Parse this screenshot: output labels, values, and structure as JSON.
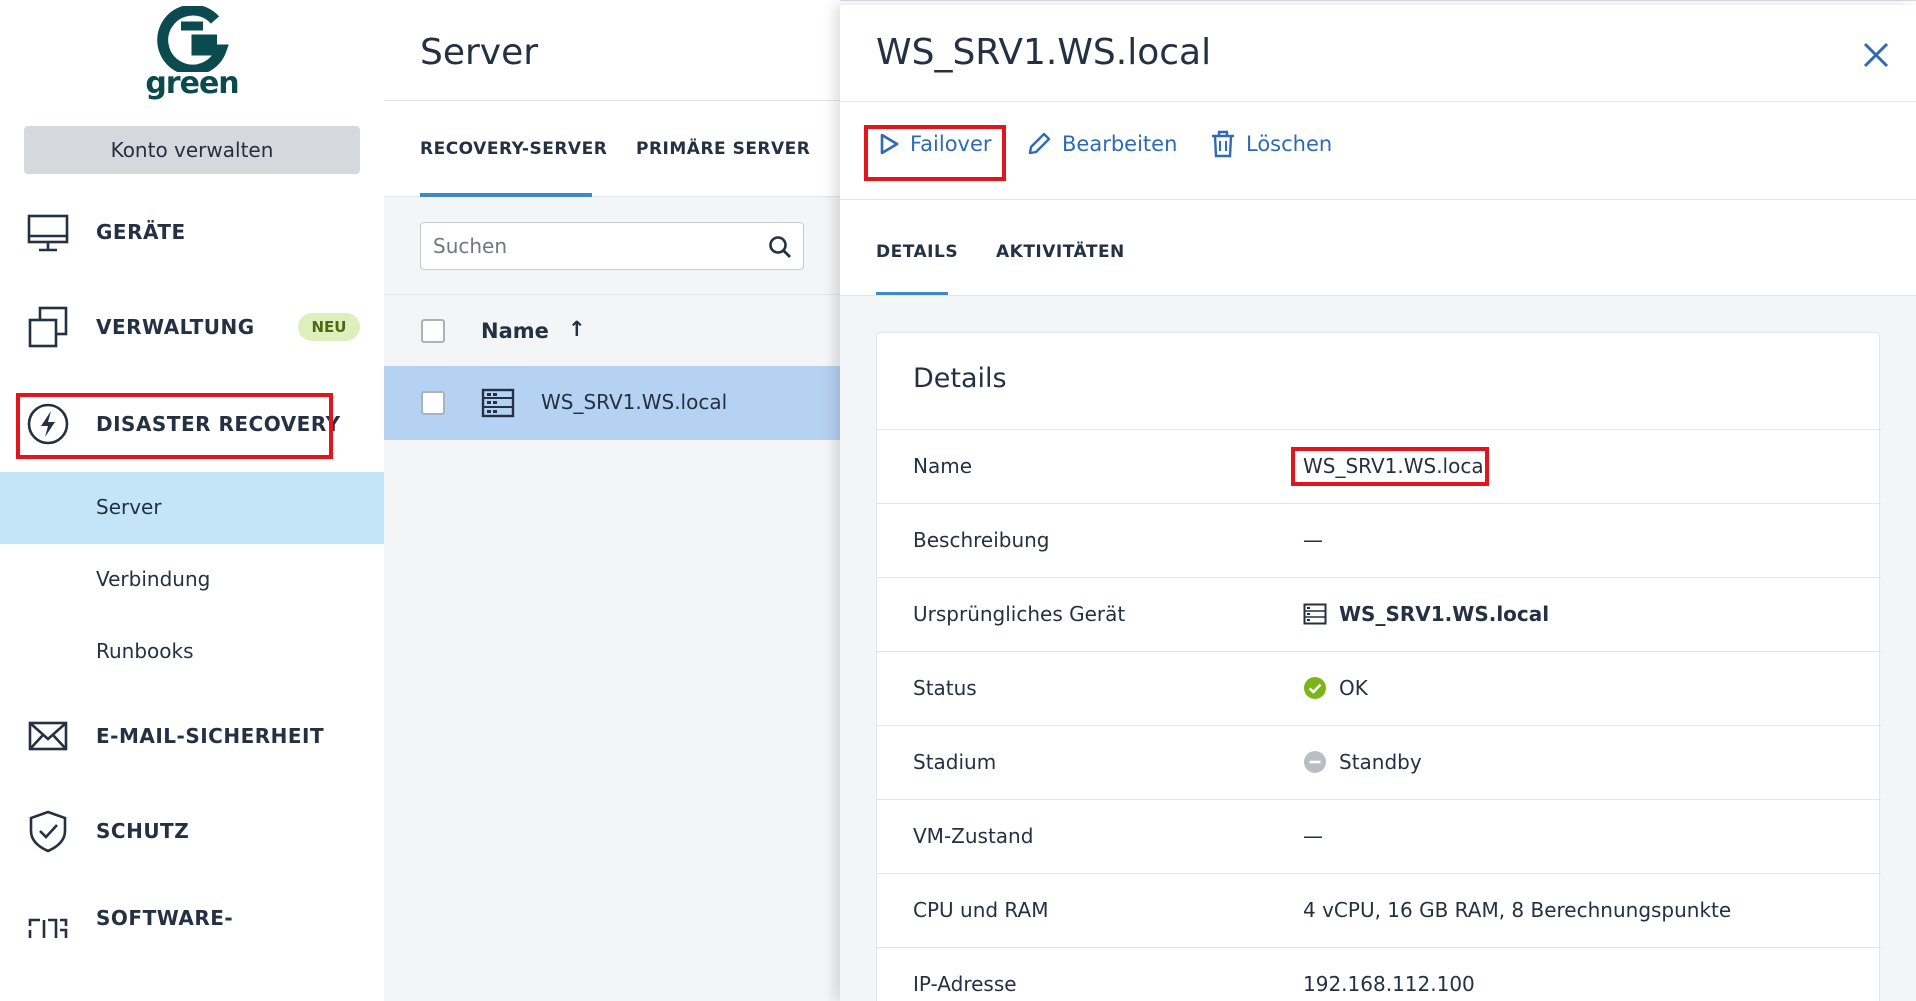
{
  "brand": {
    "logo_text": "green"
  },
  "sidebar": {
    "account_button": "Konto verwalten",
    "items": [
      {
        "label": "GERÄTE",
        "icon": "monitor-icon"
      },
      {
        "label": "VERWALTUNG",
        "icon": "copy-windows-icon",
        "badge": "NEU"
      },
      {
        "label": "DISASTER RECOVERY",
        "icon": "lightning-circle-icon"
      },
      {
        "label": "E-MAIL-SICHERHEIT",
        "icon": "envelope-icon"
      },
      {
        "label": "SCHUTZ",
        "icon": "shield-check-icon"
      },
      {
        "label": "SOFTWARE-",
        "icon": "software-icon"
      }
    ],
    "subitems": [
      "Server",
      "Verbindung",
      "Runbooks"
    ],
    "active_subitem": "Server"
  },
  "middle": {
    "title": "Server",
    "tabs": [
      "RECOVERY-SERVER",
      "PRIMÄRE SERVER"
    ],
    "active_tab": "RECOVERY-SERVER",
    "search_placeholder": "Suchen",
    "column_header": "Name",
    "sort_indicator": "↑",
    "rows": [
      {
        "name": "WS_SRV1.WS.local",
        "icon": "server-icon",
        "selected": true
      }
    ]
  },
  "detail": {
    "title": "WS_SRV1.WS.local",
    "actions": [
      {
        "label": "Failover",
        "icon": "play-icon"
      },
      {
        "label": "Bearbeiten",
        "icon": "pencil-icon"
      },
      {
        "label": "Löschen",
        "icon": "trash-icon"
      }
    ],
    "tabs": [
      "DETAILS",
      "AKTIVITÄTEN"
    ],
    "active_tab": "DETAILS",
    "card_title": "Details",
    "fields": [
      {
        "label": "Name",
        "value": "WS_SRV1.WS.local"
      },
      {
        "label": "Beschreibung",
        "value": "—"
      },
      {
        "label": "Ursprüngliches Gerät",
        "value": "WS_SRV1.WS.local",
        "icon": "server-icon"
      },
      {
        "label": "Status",
        "value": "OK",
        "icon": "check-circle-icon",
        "color": "#7cb518"
      },
      {
        "label": "Stadium",
        "value": "Standby",
        "icon": "minus-circle-icon",
        "color": "#b9bec5"
      },
      {
        "label": "VM-Zustand",
        "value": "—"
      },
      {
        "label": "CPU und RAM",
        "value": "4 vCPU, 16 GB RAM, 8 Berechnungspunkte"
      },
      {
        "label": "IP-Adresse",
        "value": "192.168.112.100"
      }
    ]
  },
  "colors": {
    "accent": "#2e6ab5",
    "highlight_box": "#e3141b",
    "selected_row": "#b6d2f2",
    "active_subnav": "#c4e4f8",
    "badge_bg": "#dfeebd"
  }
}
